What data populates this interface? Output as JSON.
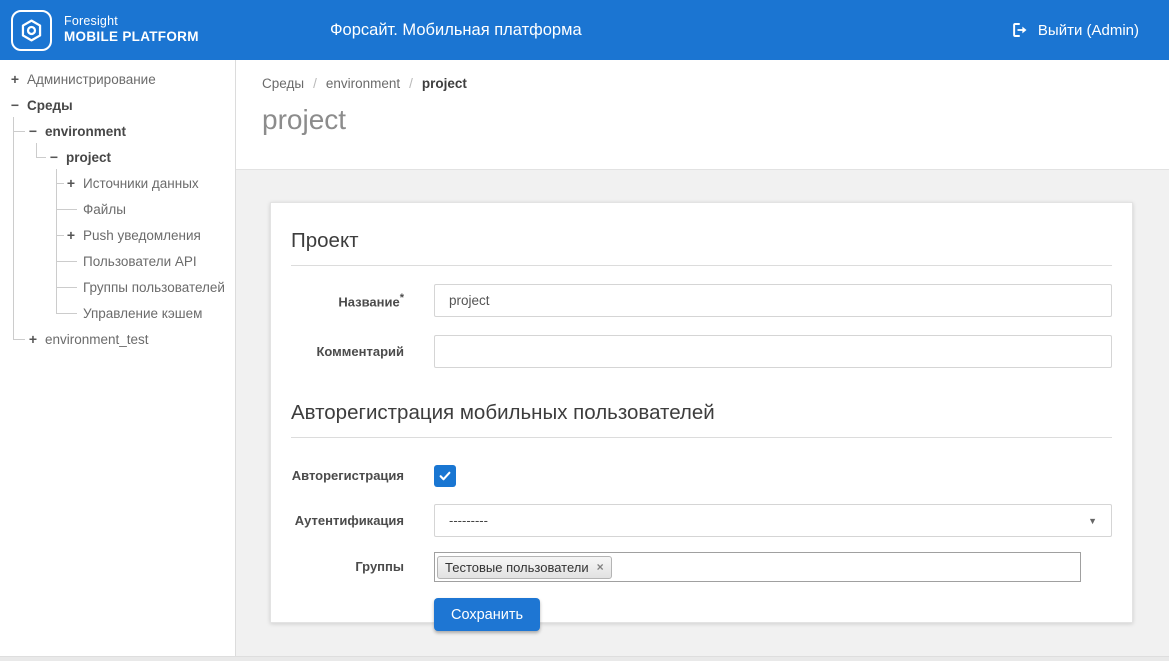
{
  "header": {
    "logo_line1": "Foresight",
    "logo_line2": "MOBILE PLATFORM",
    "title": "Форсайт. Мобильная платформа",
    "logout_label": "Выйти (Admin)"
  },
  "colors": {
    "header_bg": "#1b75d2",
    "accent_blue": "#1976d2",
    "content_bg": "#f1f1f1"
  },
  "sidebar": {
    "items": [
      {
        "label": "Администрирование",
        "toggle": "+",
        "level": 0,
        "bold": false
      },
      {
        "label": "Среды",
        "toggle": "−",
        "level": 0,
        "bold": true
      },
      {
        "label": "environment",
        "toggle": "−",
        "level": 1,
        "bold": true
      },
      {
        "label": "project",
        "toggle": "−",
        "level": 2,
        "bold": true
      },
      {
        "label": "Источники данных",
        "toggle": "+",
        "level": 3,
        "bold": false
      },
      {
        "label": "Файлы",
        "toggle": "",
        "level": 3,
        "bold": false
      },
      {
        "label": "Push уведомления",
        "toggle": "+",
        "level": 3,
        "bold": false
      },
      {
        "label": "Пользователи API",
        "toggle": "",
        "level": 3,
        "bold": false
      },
      {
        "label": "Группы пользователей",
        "toggle": "",
        "level": 3,
        "bold": false
      },
      {
        "label": "Управление кэшем",
        "toggle": "",
        "level": 3,
        "bold": false
      },
      {
        "label": "environment_test",
        "toggle": "+",
        "level": 1,
        "bold": false
      }
    ]
  },
  "breadcrumb": {
    "separator": "/",
    "items": [
      "Среды",
      "environment",
      "project"
    ]
  },
  "page": {
    "title": "project"
  },
  "form": {
    "section1_title": "Проект",
    "name_label": "Название",
    "required_mark": "*",
    "name_value": "project",
    "comment_label": "Комментарий",
    "comment_value": "",
    "section2_title": "Авторегистрация мобильных пользователей",
    "autoreg_label": "Авторегистрация",
    "autoreg_checked": true,
    "auth_label": "Аутентификация",
    "auth_value": "---------",
    "groups_label": "Группы",
    "groups_tags": [
      {
        "label": "Тестовые пользователи",
        "remove": "×"
      }
    ],
    "save_label": "Сохранить"
  }
}
